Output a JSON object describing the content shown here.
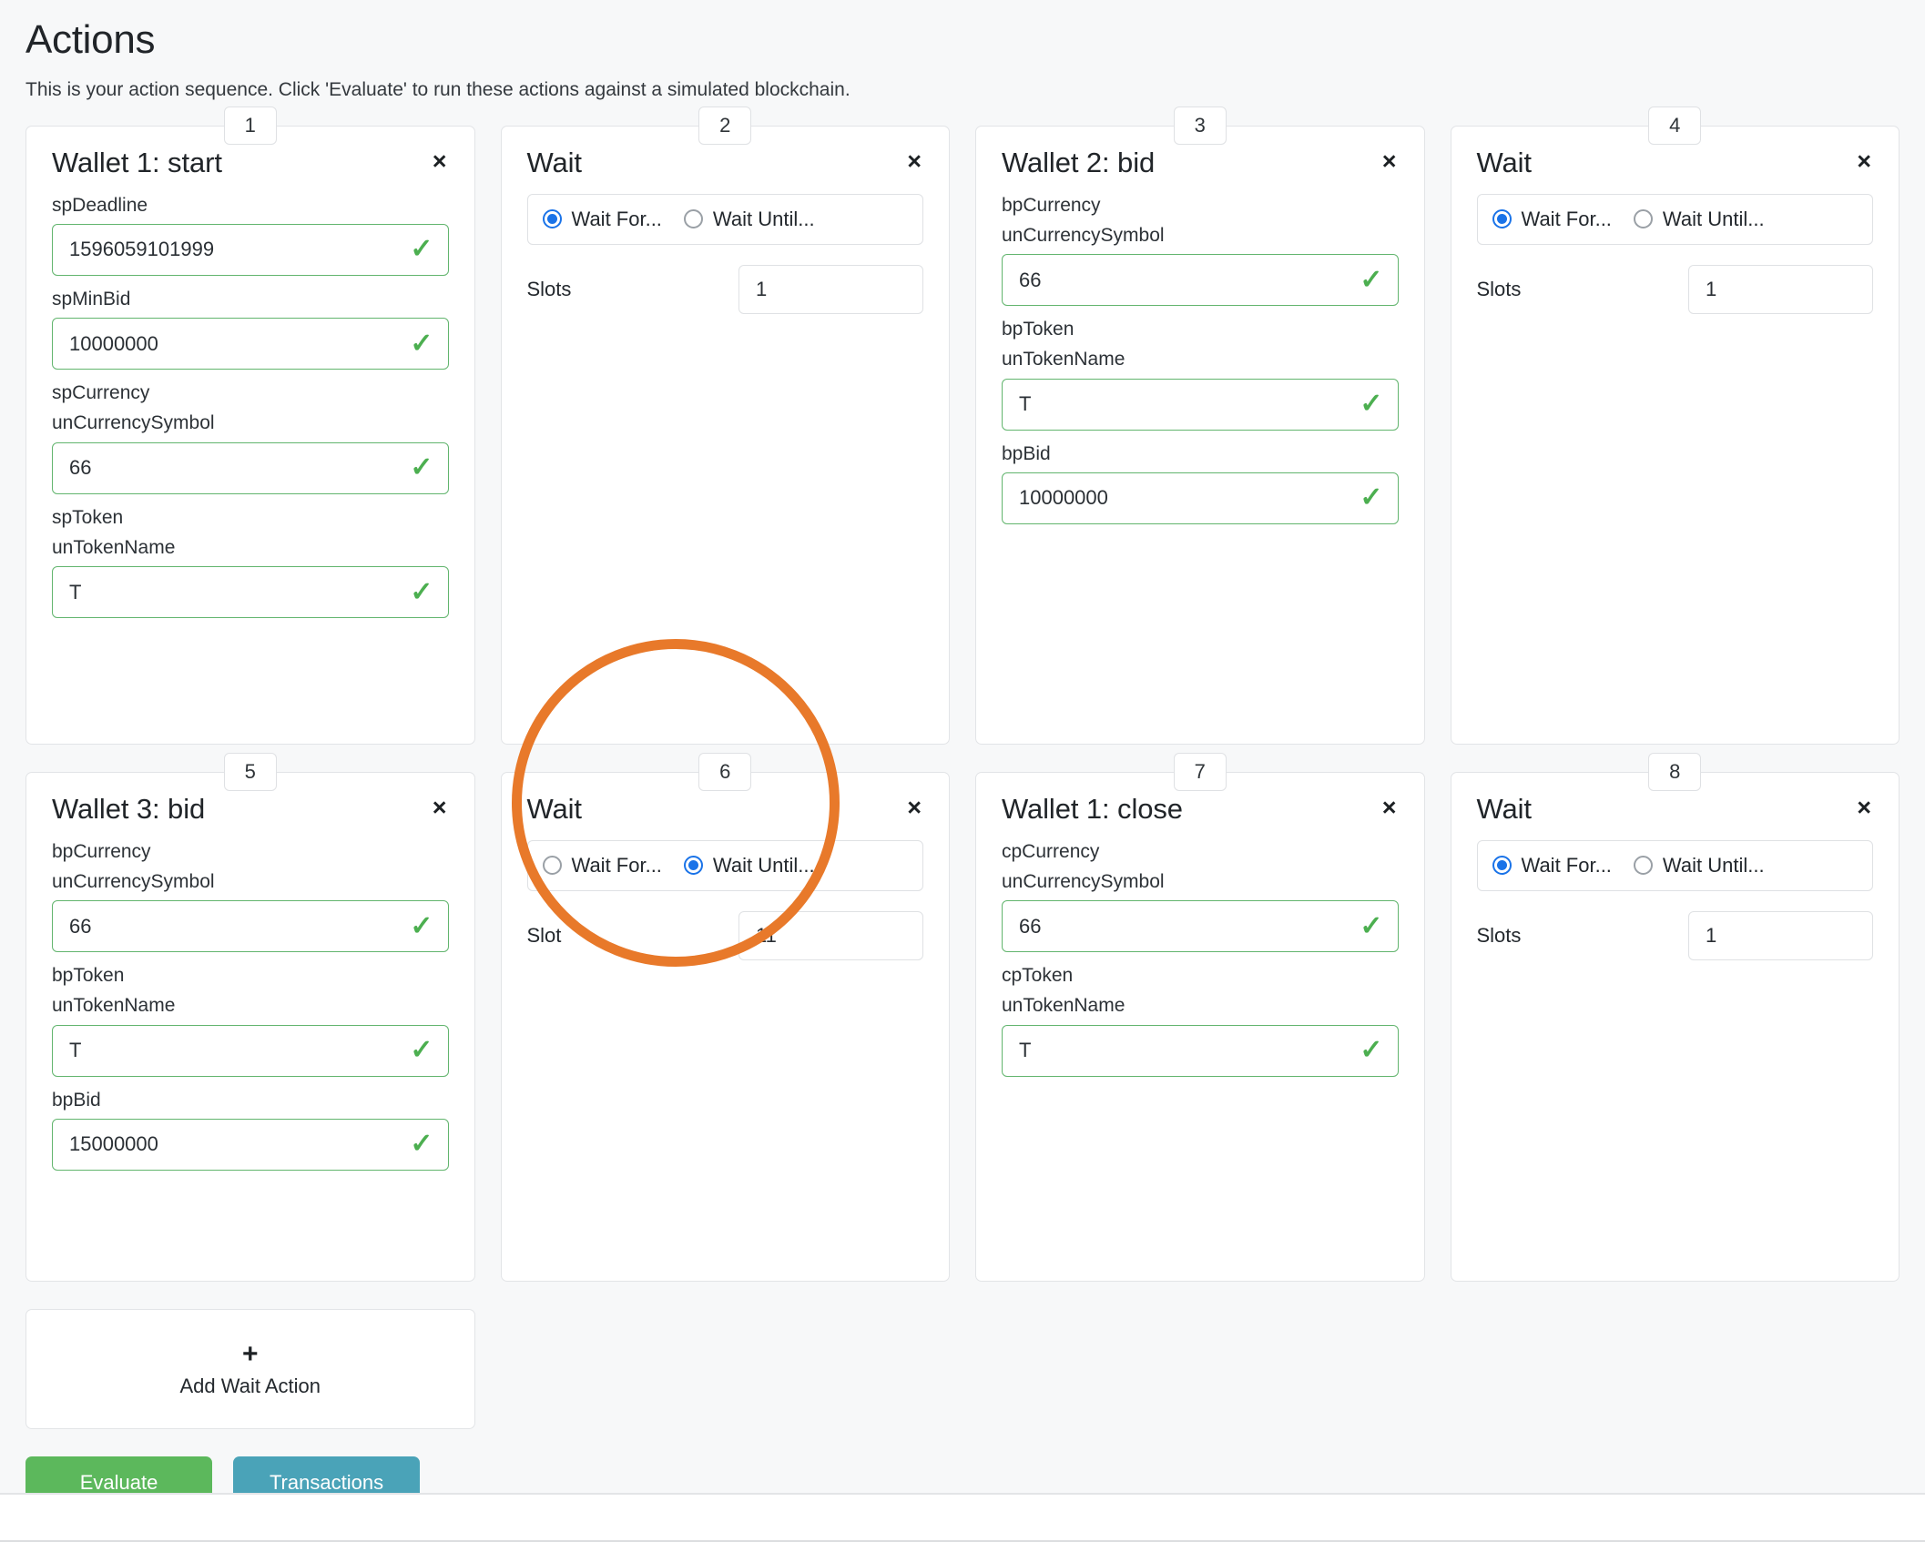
{
  "header": {
    "title": "Actions",
    "subtitle": "This is your action sequence. Click 'Evaluate' to run these actions against a simulated blockchain."
  },
  "icons": {
    "close": "×",
    "tick": "✓",
    "plus": "+"
  },
  "cards": [
    {
      "step": "1",
      "title": "Wallet 1: start",
      "type": "wallet",
      "fields": [
        {
          "label": "spDeadline",
          "sublabel": null,
          "value": "1596059101999",
          "valid": true
        },
        {
          "label": "spMinBid",
          "sublabel": null,
          "value": "10000000",
          "valid": true
        },
        {
          "label": "spCurrency",
          "sublabel": "unCurrencySymbol",
          "value": "66",
          "valid": true
        },
        {
          "label": "spToken",
          "sublabel": "unTokenName",
          "value": "T",
          "valid": true
        }
      ]
    },
    {
      "step": "2",
      "title": "Wait",
      "type": "wait",
      "options": [
        {
          "label": "Wait For...",
          "selected": true
        },
        {
          "label": "Wait Until...",
          "selected": false
        }
      ],
      "slot_label": "Slots",
      "slot_value": "1"
    },
    {
      "step": "3",
      "title": "Wallet 2: bid",
      "type": "wallet",
      "fields": [
        {
          "label": "bpCurrency",
          "sublabel": "unCurrencySymbol",
          "value": "66",
          "valid": true
        },
        {
          "label": "bpToken",
          "sublabel": "unTokenName",
          "value": "T",
          "valid": true
        },
        {
          "label": "bpBid",
          "sublabel": null,
          "value": "10000000",
          "valid": true
        }
      ]
    },
    {
      "step": "4",
      "title": "Wait",
      "type": "wait",
      "options": [
        {
          "label": "Wait For...",
          "selected": true
        },
        {
          "label": "Wait Until...",
          "selected": false
        }
      ],
      "slot_label": "Slots",
      "slot_value": "1"
    },
    {
      "step": "5",
      "title": "Wallet 3: bid",
      "type": "wallet",
      "fields": [
        {
          "label": "bpCurrency",
          "sublabel": "unCurrencySymbol",
          "value": "66",
          "valid": true
        },
        {
          "label": "bpToken",
          "sublabel": "unTokenName",
          "value": "T",
          "valid": true
        },
        {
          "label": "bpBid",
          "sublabel": null,
          "value": "15000000",
          "valid": true
        }
      ]
    },
    {
      "step": "6",
      "title": "Wait",
      "type": "wait",
      "highlighted": true,
      "options": [
        {
          "label": "Wait For...",
          "selected": false
        },
        {
          "label": "Wait Until...",
          "selected": true
        }
      ],
      "slot_label": "Slot",
      "slot_value": "11"
    },
    {
      "step": "7",
      "title": "Wallet 1: close",
      "type": "wallet",
      "fields": [
        {
          "label": "cpCurrency",
          "sublabel": "unCurrencySymbol",
          "value": "66",
          "valid": true
        },
        {
          "label": "cpToken",
          "sublabel": "unTokenName",
          "value": "T",
          "valid": true
        }
      ]
    },
    {
      "step": "8",
      "title": "Wait",
      "type": "wait",
      "options": [
        {
          "label": "Wait For...",
          "selected": true
        },
        {
          "label": "Wait Until...",
          "selected": false
        }
      ],
      "slot_label": "Slots",
      "slot_value": "1"
    }
  ],
  "add_action": {
    "label": "Add Wait Action"
  },
  "buttons": {
    "evaluate": "Evaluate",
    "transactions": "Transactions"
  },
  "colors": {
    "valid_border": "#62b56e",
    "valid_tick": "#4caf50",
    "radio_selected": "#1a73e8",
    "evaluate": "#5cb85c",
    "transactions": "#4aa3b8",
    "annotation": "#e8792a",
    "page_background": "#f7f8f9"
  }
}
